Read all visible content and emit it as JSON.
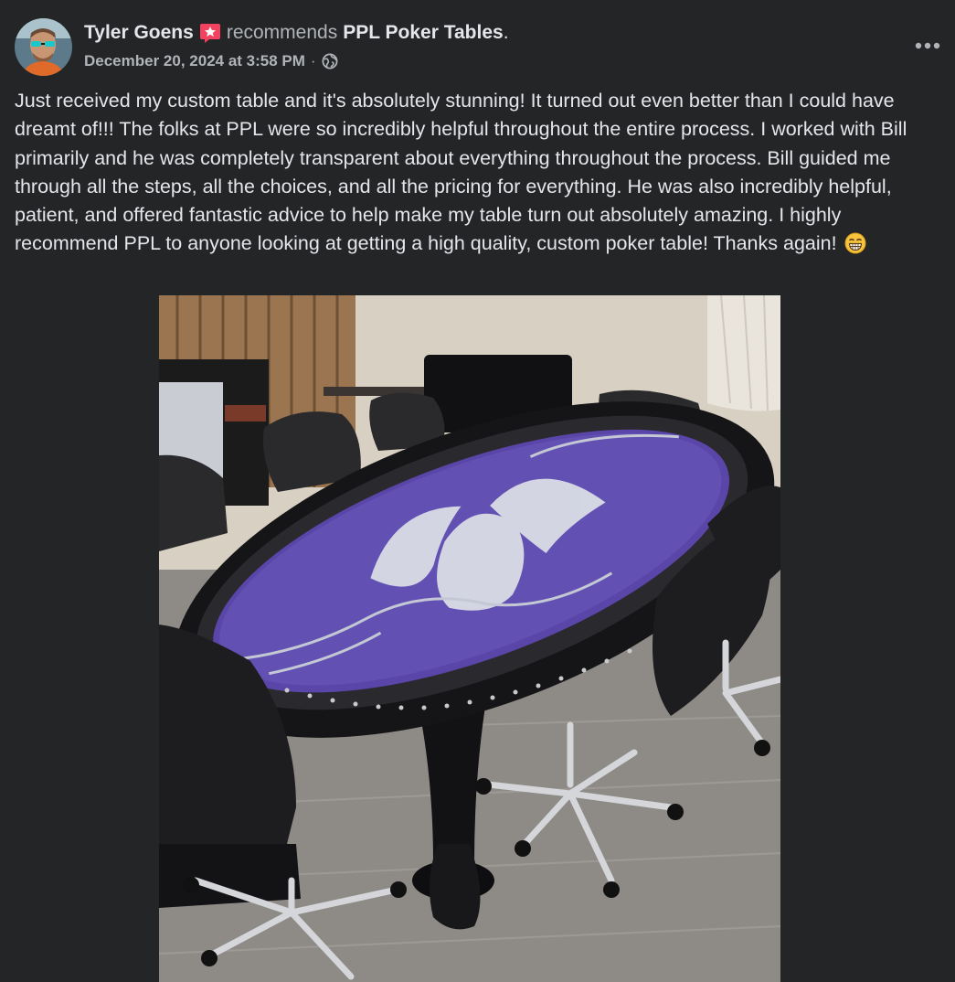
{
  "post": {
    "author": "Tyler Goens",
    "recommends_word": "recommends",
    "page": "PPL Poker Tables",
    "period": ".",
    "timestamp": "December 20, 2024 at 3:58 PM",
    "separator": "·",
    "privacy_icon": "globe-icon",
    "more_icon": "more-options-icon",
    "body": "Just received my custom table and it's absolutely stunning! It turned out even better than I could have dreamt of!!! The folks at PPL were so incredibly helpful throughout the entire process. I worked with Bill primarily and he was completely transparent about everything throughout the process. Bill guided me through all the steps, all the choices, and all the pricing for everything. He was also incredibly helpful, patient, and offered fantastic advice to help make my table turn out absolutely amazing. I highly recommend PPL to anyone looking at getting a high quality, custom poker table! Thanks again!",
    "emoji": "grinning-face-emoji",
    "photo_subject": "custom poker table photo"
  },
  "colors": {
    "background": "#242526",
    "primary_text": "#e4e6eb",
    "secondary_text": "#b0b3b8",
    "recommend_badge": "#f3425f",
    "felt": "#5a45a8"
  }
}
